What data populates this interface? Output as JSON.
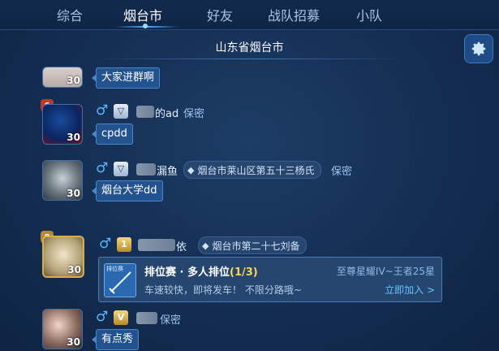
{
  "tabs": [
    {
      "label": "综合",
      "active": false
    },
    {
      "label": "烟台市",
      "active": true
    },
    {
      "label": "好友",
      "active": false
    },
    {
      "label": "战队招募",
      "active": false
    },
    {
      "label": "小队",
      "active": false
    }
  ],
  "channel": {
    "title": "山东省烟台市"
  },
  "settings": {
    "icon": "gear-icon"
  },
  "colors": {
    "accent": "#58b2ff",
    "bubble": "#23538f",
    "gold": "#ffd54d",
    "link": "#67c4ff"
  },
  "messages": [
    {
      "avatar_level": "30",
      "text": "大家进群啊"
    },
    {
      "avatar_level": "30",
      "badge": "6",
      "name_suffix": "的ad",
      "privacy": "保密",
      "text": "cpdd"
    },
    {
      "avatar_level": "30",
      "name_suffix": "漏鱼",
      "location": "烟台市莱山区第五十三杨氏",
      "privacy": "保密",
      "text": "烟台大学dd"
    },
    {
      "avatar_level": "30",
      "badge": "8",
      "rank_badge": "1",
      "name_suffix": "依",
      "location": "烟台市第二十七刘备"
    },
    {
      "avatar_level": "30",
      "rank_badge": "V",
      "privacy": "保密",
      "text": "有点秀"
    }
  ],
  "invite_card": {
    "icon_label": "排位赛",
    "title": "排位赛 · 多人排位",
    "count": "(1/3)",
    "rank_range": "至尊星耀IV~王者25星",
    "description": "车速较快，即将发车！ 不限分路哦~",
    "join_label": "立即加入 >"
  }
}
